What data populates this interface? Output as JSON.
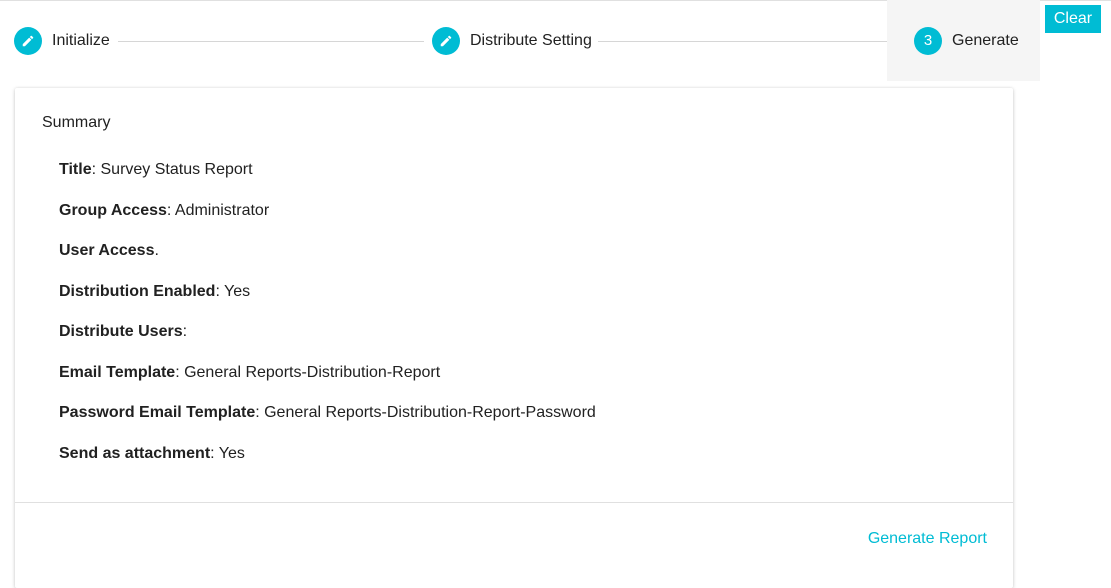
{
  "stepper": {
    "steps": [
      {
        "label": "Initialize",
        "icon": "pencil-icon"
      },
      {
        "label": "Distribute Setting",
        "icon": "pencil-icon"
      },
      {
        "label": "Generate",
        "number": "3",
        "active": true
      }
    ],
    "accent_color": "#00bcd4"
  },
  "toolbar": {
    "clear_label": "Clear"
  },
  "summary": {
    "title": "Summary",
    "items": [
      {
        "key": "Title",
        "value": ": Survey Status Report"
      },
      {
        "key": "Group Access",
        "value": ": Administrator"
      },
      {
        "key": "User Access",
        "value": "."
      },
      {
        "key": "Distribution Enabled",
        "value": ": Yes"
      },
      {
        "key": "Distribute Users",
        "value": ":"
      },
      {
        "key": "Email Template",
        "value": ": General Reports-Distribution-Report"
      },
      {
        "key": "Password Email Template",
        "value": ": General Reports-Distribution-Report-Password"
      },
      {
        "key": "Send as attachment",
        "value": ": Yes"
      }
    ],
    "generate_label": "Generate Report"
  }
}
